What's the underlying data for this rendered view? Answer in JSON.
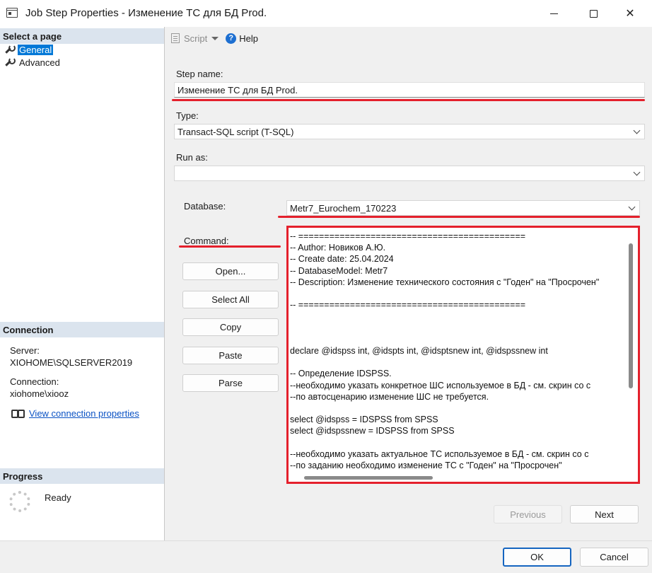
{
  "window": {
    "title": "Job Step Properties - Изменение ТС для БД Prod."
  },
  "left_panel": {
    "select_page_header": "Select a page",
    "pages": [
      {
        "label": "General",
        "selected": true
      },
      {
        "label": "Advanced",
        "selected": false
      }
    ],
    "connection_header": "Connection",
    "server_label": "Server:",
    "server_value": "XIOHOME\\SQLSERVER2019",
    "connection_label": "Connection:",
    "connection_value": "xiohome\\xiooz",
    "view_connection_link": "View connection properties",
    "progress_header": "Progress",
    "progress_status": "Ready"
  },
  "toolbar": {
    "script_label": "Script",
    "help_label": "Help"
  },
  "form": {
    "step_name_label": "Step name:",
    "step_name_value": "Изменение ТС для БД Prod.",
    "type_label": "Type:",
    "type_value": "Transact-SQL script (T-SQL)",
    "run_as_label": "Run as:",
    "run_as_value": "",
    "database_label": "Database:",
    "database_value": "Metr7_Eurochem_170223",
    "command_label": "Command:"
  },
  "command_buttons": {
    "open": "Open...",
    "select_all": "Select All",
    "copy": "Copy",
    "paste": "Paste",
    "parse": "Parse"
  },
  "command_text": "-- ============================================\n-- Author: Новиков А.Ю.\n-- Create date: 25.04.2024\n-- DatabaseModel: Metr7\n-- Description: Изменение технического состояния с \"Годен\" на \"Просрочен\"\n\n-- ============================================\n\n\n\ndeclare @idspss int, @idspts int, @idsptsnew int, @idspssnew int\n\n-- Определение IDSPSS.\n--необходимо указать конкретное ШС используемое в БД - см. скрин со с\n--по автосценарию изменение ШС не требуется.\n\nselect @idspss = IDSPSS from SPSS\nselect @idspssnew = IDSPSS from SPSS\n\n--необходимо указать актуальное ТС используемое в БД - см. скрин со с\n--по заданию необходимо изменение ТС с \"Годен\" на \"Просрочен\"\n\n-- Определение @idspts по ТС \"Годен\"",
  "nav_buttons": {
    "previous": "Previous",
    "next": "Next"
  },
  "dialog_buttons": {
    "ok": "OK",
    "cancel": "Cancel"
  },
  "colors": {
    "highlight_red": "#e4202c",
    "selection_blue": "#0078d7",
    "section_header_bg": "#dbe4ee",
    "link_blue": "#0a52c4"
  }
}
